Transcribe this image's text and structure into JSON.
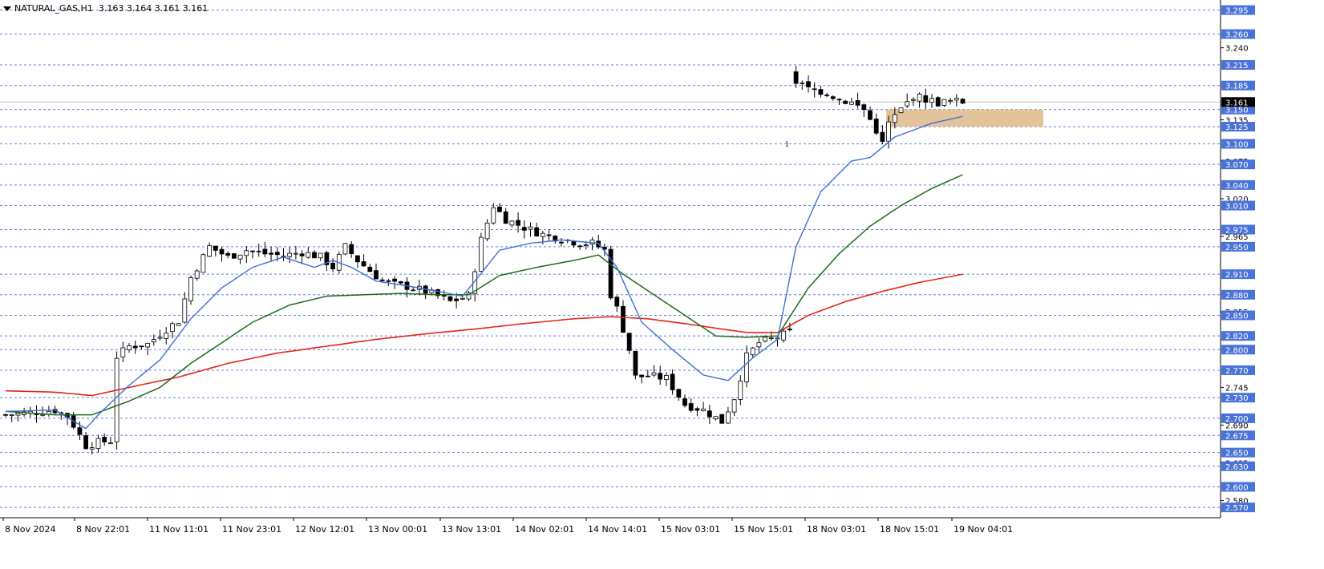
{
  "header": {
    "symbol": "NATURAL_GAS,H1",
    "ohlc": "3.163 3.164 3.161 3.161"
  },
  "colors": {
    "background": "#ffffff",
    "gridline": "#4b6fd1",
    "axis_label_bg": "#4a73d9",
    "current_price_bg": "#000000",
    "candle_up": "#ffffff",
    "candle_down": "#000000",
    "ma_fast": "#3e6fd6",
    "ma_mid": "#1f6b1a",
    "ma_slow": "#e3261b",
    "zone": "#deb887"
  },
  "chart_data": {
    "type": "candlestick",
    "y_range": [
      2.555,
      3.305
    ],
    "current_price": "3.161",
    "horizontal_levels": [
      "3.295",
      "3.260",
      "3.215",
      "3.185",
      "3.150",
      "3.125",
      "3.100",
      "3.070",
      "3.040",
      "3.010",
      "2.975",
      "2.950",
      "2.910",
      "2.880",
      "2.850",
      "2.820",
      "2.800",
      "2.770",
      "2.730",
      "2.700",
      "2.675",
      "2.650",
      "2.630",
      "2.600",
      "2.570"
    ],
    "y_tick_labels": [
      "3.240",
      "3.135",
      "3.075",
      "3.020",
      "2.965",
      "2.855",
      "2.745",
      "2.690",
      "2.635",
      "2.580"
    ],
    "x_tick_labels": [
      "8 Nov 2024",
      "8 Nov 22:01",
      "11 Nov 11:01",
      "11 Nov 23:01",
      "12 Nov 12:01",
      "13 Nov 00:01",
      "13 Nov 13:01",
      "14 Nov 02:01",
      "14 Nov 14:01",
      "15 Nov 03:01",
      "15 Nov 15:01",
      "18 Nov 03:01",
      "18 Nov 15:01",
      "19 Nov 04:01"
    ],
    "zone": {
      "from": 3.15,
      "to": 3.125,
      "start_bar": 143,
      "end_bar": 170
    },
    "marker_label": "1",
    "close_keypoints": [
      [
        0,
        2.705
      ],
      [
        4,
        2.708
      ],
      [
        8,
        2.712
      ],
      [
        10,
        2.703
      ],
      [
        11,
        2.69
      ],
      [
        12,
        2.675
      ],
      [
        13,
        2.66
      ],
      [
        15,
        2.665
      ],
      [
        17,
        2.667
      ],
      [
        18,
        2.79
      ],
      [
        20,
        2.805
      ],
      [
        23,
        2.808
      ],
      [
        26,
        2.83
      ],
      [
        28,
        2.842
      ],
      [
        30,
        2.905
      ],
      [
        33,
        2.95
      ],
      [
        36,
        2.935
      ],
      [
        39,
        2.945
      ],
      [
        42,
        2.94
      ],
      [
        45,
        2.937
      ],
      [
        48,
        2.942
      ],
      [
        51,
        2.935
      ],
      [
        53,
        2.92
      ],
      [
        55,
        2.95
      ],
      [
        57,
        2.93
      ],
      [
        59,
        2.915
      ],
      [
        61,
        2.9
      ],
      [
        63,
        2.895
      ],
      [
        65,
        2.892
      ],
      [
        68,
        2.885
      ],
      [
        70,
        2.878
      ],
      [
        72,
        2.87
      ],
      [
        75,
        2.878
      ],
      [
        77,
        2.96
      ],
      [
        79,
        3.01
      ],
      [
        81,
        2.99
      ],
      [
        84,
        2.978
      ],
      [
        87,
        2.968
      ],
      [
        90,
        2.962
      ],
      [
        93,
        2.955
      ],
      [
        95,
        2.955
      ],
      [
        97,
        2.945
      ],
      [
        98,
        2.88
      ],
      [
        99,
        2.86
      ],
      [
        101,
        2.8
      ],
      [
        102,
        2.76
      ],
      [
        104,
        2.762
      ],
      [
        107,
        2.758
      ],
      [
        110,
        2.72
      ],
      [
        113,
        2.712
      ],
      [
        116,
        2.695
      ],
      [
        118,
        2.73
      ],
      [
        120,
        2.79
      ],
      [
        122,
        2.81
      ],
      [
        124,
        2.815
      ],
      [
        127,
        2.825
      ],
      [
        128,
        3.19
      ],
      [
        130,
        3.18
      ],
      [
        133,
        3.175
      ],
      [
        135,
        3.165
      ],
      [
        137,
        3.16
      ],
      [
        139,
        3.15
      ],
      [
        141,
        3.12
      ],
      [
        142,
        3.1
      ],
      [
        143,
        3.13
      ],
      [
        145,
        3.15
      ],
      [
        147,
        3.17
      ],
      [
        149,
        3.165
      ],
      [
        151,
        3.16
      ],
      [
        153,
        3.162
      ],
      [
        155,
        3.161
      ]
    ],
    "ma_fast_keypoints": [
      [
        0,
        2.71
      ],
      [
        8,
        2.712
      ],
      [
        13,
        2.685
      ],
      [
        15,
        2.705
      ],
      [
        20,
        2.748
      ],
      [
        25,
        2.785
      ],
      [
        30,
        2.845
      ],
      [
        35,
        2.89
      ],
      [
        40,
        2.92
      ],
      [
        45,
        2.935
      ],
      [
        50,
        2.92
      ],
      [
        53,
        2.93
      ],
      [
        56,
        2.92
      ],
      [
        60,
        2.9
      ],
      [
        65,
        2.893
      ],
      [
        70,
        2.885
      ],
      [
        74,
        2.878
      ],
      [
        76,
        2.9
      ],
      [
        80,
        2.945
      ],
      [
        85,
        2.955
      ],
      [
        90,
        2.96
      ],
      [
        96,
        2.955
      ],
      [
        99,
        2.92
      ],
      [
        103,
        2.84
      ],
      [
        108,
        2.8
      ],
      [
        113,
        2.763
      ],
      [
        117,
        2.755
      ],
      [
        121,
        2.788
      ],
      [
        125,
        2.815
      ],
      [
        128,
        2.95
      ],
      [
        132,
        3.03
      ],
      [
        137,
        3.075
      ],
      [
        140,
        3.08
      ],
      [
        144,
        3.11
      ],
      [
        150,
        3.13
      ],
      [
        155,
        3.14
      ]
    ],
    "ma_mid_keypoints": [
      [
        0,
        2.71
      ],
      [
        8,
        2.705
      ],
      [
        14,
        2.705
      ],
      [
        20,
        2.725
      ],
      [
        25,
        2.745
      ],
      [
        30,
        2.78
      ],
      [
        35,
        2.81
      ],
      [
        40,
        2.84
      ],
      [
        46,
        2.865
      ],
      [
        52,
        2.878
      ],
      [
        58,
        2.88
      ],
      [
        64,
        2.882
      ],
      [
        70,
        2.88
      ],
      [
        75,
        2.88
      ],
      [
        80,
        2.908
      ],
      [
        86,
        2.92
      ],
      [
        92,
        2.93
      ],
      [
        96,
        2.938
      ],
      [
        100,
        2.91
      ],
      [
        105,
        2.88
      ],
      [
        110,
        2.85
      ],
      [
        115,
        2.82
      ],
      [
        120,
        2.818
      ],
      [
        125,
        2.82
      ],
      [
        130,
        2.89
      ],
      [
        135,
        2.94
      ],
      [
        140,
        2.98
      ],
      [
        145,
        3.01
      ],
      [
        150,
        3.035
      ],
      [
        155,
        3.055
      ]
    ],
    "ma_slow_keypoints": [
      [
        0,
        2.74
      ],
      [
        8,
        2.738
      ],
      [
        14,
        2.733
      ],
      [
        20,
        2.745
      ],
      [
        28,
        2.76
      ],
      [
        36,
        2.78
      ],
      [
        44,
        2.795
      ],
      [
        52,
        2.805
      ],
      [
        60,
        2.815
      ],
      [
        68,
        2.823
      ],
      [
        76,
        2.83
      ],
      [
        84,
        2.838
      ],
      [
        92,
        2.845
      ],
      [
        98,
        2.848
      ],
      [
        104,
        2.845
      ],
      [
        110,
        2.838
      ],
      [
        116,
        2.83
      ],
      [
        120,
        2.825
      ],
      [
        125,
        2.825
      ],
      [
        130,
        2.85
      ],
      [
        136,
        2.87
      ],
      [
        142,
        2.885
      ],
      [
        148,
        2.898
      ],
      [
        155,
        2.91
      ]
    ]
  }
}
